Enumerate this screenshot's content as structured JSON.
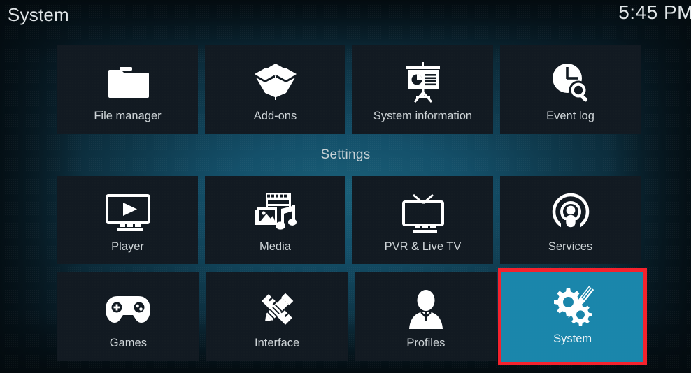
{
  "header": {
    "title": "System",
    "clock": "5:45 PM"
  },
  "sections": {
    "settings_label": "Settings"
  },
  "colors": {
    "selected_fill": "#1a86ab",
    "selection_border": "#f5222d",
    "tile_fill": "#121a22",
    "label_text": "#ced4d7",
    "background_center": "#1a5f78",
    "background_edge": "#081d28"
  },
  "rows": {
    "top": [
      {
        "label": "File manager",
        "icon": "folder-icon",
        "selected": false
      },
      {
        "label": "Add-ons",
        "icon": "open-box-icon",
        "selected": false
      },
      {
        "label": "System information",
        "icon": "presentation-chart-icon",
        "selected": false
      },
      {
        "label": "Event log",
        "icon": "clock-search-icon",
        "selected": false
      }
    ],
    "middle": [
      {
        "label": "Player",
        "icon": "monitor-play-icon",
        "selected": false
      },
      {
        "label": "Media",
        "icon": "film-photo-music-icon",
        "selected": false
      },
      {
        "label": "PVR & Live TV",
        "icon": "tv-antenna-icon",
        "selected": false
      },
      {
        "label": "Services",
        "icon": "broadcast-person-icon",
        "selected": false
      }
    ],
    "bottom": [
      {
        "label": "Games",
        "icon": "gamepad-icon",
        "selected": false
      },
      {
        "label": "Interface",
        "icon": "pencil-ruler-icon",
        "selected": false
      },
      {
        "label": "Profiles",
        "icon": "person-icon",
        "selected": false
      },
      {
        "label": "System",
        "icon": "gears-screwdriver-icon",
        "selected": true
      }
    ]
  }
}
